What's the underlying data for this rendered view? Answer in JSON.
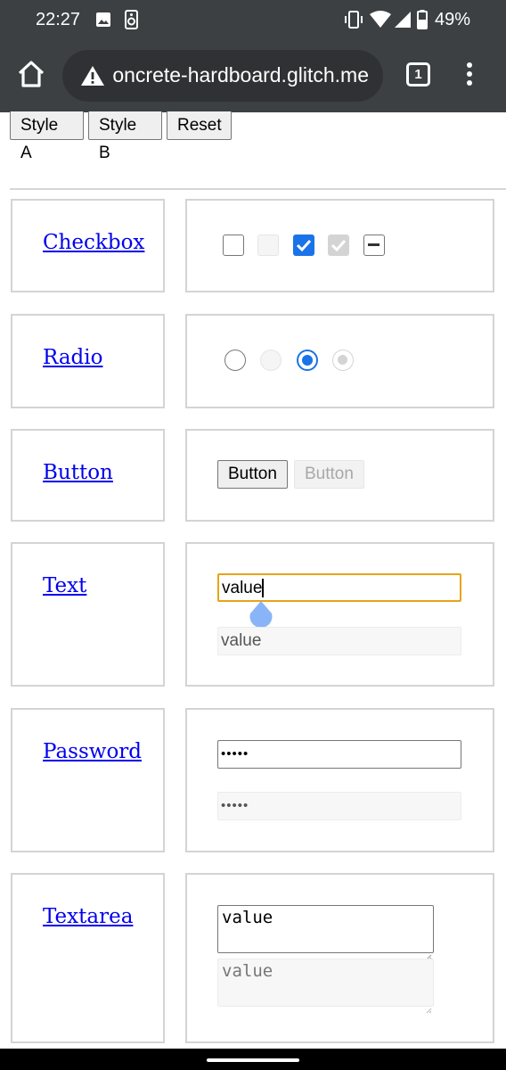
{
  "status_bar": {
    "time": "22:27",
    "battery_percent": "49%",
    "icons": [
      "image-icon",
      "speaker-icon",
      "vibrate-icon",
      "wifi-icon",
      "signal-icon",
      "battery-icon"
    ]
  },
  "browser": {
    "url": "concrete-hardboard.glitch.me",
    "tab_count": "1",
    "icons": [
      "home-icon",
      "warning-icon",
      "more-vert-icon"
    ]
  },
  "style_buttons": [
    "Style A",
    "Style B",
    "Reset"
  ],
  "rows": {
    "checkbox": {
      "label": "Checkbox",
      "states": [
        "unchecked",
        "disabled-unchecked",
        "checked",
        "disabled-checked",
        "indeterminate"
      ]
    },
    "radio": {
      "label": "Radio",
      "states": [
        "unchecked",
        "disabled-unchecked",
        "checked",
        "disabled-checked"
      ]
    },
    "button": {
      "label": "Button",
      "enabled_label": "Button",
      "disabled_label": "Button"
    },
    "text": {
      "label": "Text",
      "value": "value",
      "disabled_value": "value"
    },
    "password": {
      "label": "Password",
      "value": "•••••",
      "disabled_value": "•••••"
    },
    "textarea": {
      "label": "Textarea",
      "value": "value",
      "disabled_value": "value"
    }
  },
  "colors": {
    "chrome_bg": "#3c4043",
    "url_bg": "#303134",
    "accent": "#1a73e8",
    "focus_ring": "#e8a317",
    "link": "#0000ee",
    "caret_handle": "#8ab4f8"
  }
}
